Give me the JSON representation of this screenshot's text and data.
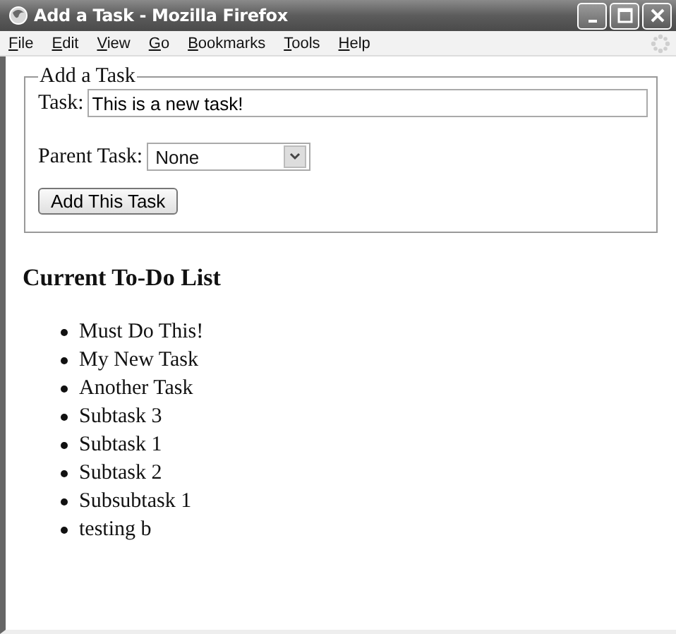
{
  "window": {
    "title": "Add a Task - Mozilla Firefox"
  },
  "menu": [
    "File",
    "Edit",
    "View",
    "Go",
    "Bookmarks",
    "Tools",
    "Help"
  ],
  "form": {
    "legend": "Add a Task",
    "task_label": "Task:",
    "task_value": "This is a new task!",
    "parent_label": "Parent Task:",
    "parent_value": "None",
    "button": "Add This Task"
  },
  "list": {
    "heading": "Current To-Do List",
    "items": [
      {
        "label": "Must Do This!"
      },
      {
        "label": "My New Task"
      },
      {
        "label": "Another Task"
      },
      {
        "label": "Subtask 3"
      },
      {
        "label": "Subtask 1"
      },
      {
        "label": "Subtask 2"
      },
      {
        "label": "Subsubtask 1"
      },
      {
        "label": "testing b"
      }
    ]
  }
}
